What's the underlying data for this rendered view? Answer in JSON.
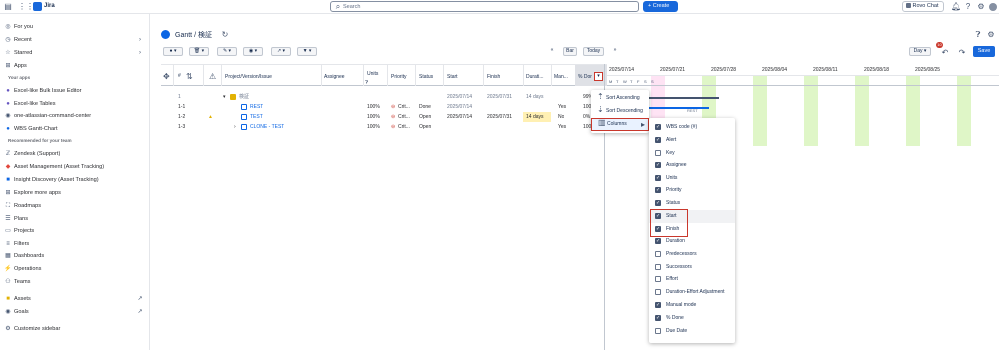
{
  "app": {
    "name": "Jira"
  },
  "topbar": {
    "search_placeholder": "Search",
    "create_label": "Create",
    "rovo_label": "Rovo Chat",
    "badge": "10"
  },
  "sidebar": {
    "items_top": [
      {
        "label": "For you",
        "icon": "target-icon"
      },
      {
        "label": "Recent",
        "icon": "clock-icon",
        "chevron": true
      },
      {
        "label": "Starred",
        "icon": "star-icon",
        "chevron": true
      },
      {
        "label": "Apps",
        "icon": "apps-icon",
        "chevron": false
      }
    ],
    "your_apps_heading": "Your apps",
    "your_apps": [
      {
        "label": "Excel-like Bulk Issue Editor"
      },
      {
        "label": "Excel-like Tables"
      },
      {
        "label": "one-atlassian-command-center"
      },
      {
        "label": "WBS Gantt-Chart"
      }
    ],
    "recommended_heading": "Recommended for your team",
    "recommended": [
      {
        "label": "Zendesk (Support)"
      },
      {
        "label": "Asset Management (Asset Tracking)"
      },
      {
        "label": "Insight Discovery (Asset Tracking)"
      },
      {
        "label": "Explore more apps"
      }
    ],
    "items_bottom": [
      {
        "label": "Roadmaps"
      },
      {
        "label": "Plans"
      },
      {
        "label": "Projects"
      },
      {
        "label": "Filters"
      },
      {
        "label": "Dashboards"
      },
      {
        "label": "Operations"
      },
      {
        "label": "Teams"
      },
      {
        "label": "Assets"
      },
      {
        "label": "Goals"
      },
      {
        "label": "Customize sidebar"
      }
    ]
  },
  "page": {
    "title": "Gantt / 検証"
  },
  "toolbar": {
    "bar_label": "Bar",
    "today_label": "Today",
    "day_label": "Day",
    "save_label": "Save"
  },
  "grid": {
    "headers": [
      "#",
      "Project/Version/Issue",
      "Assignee",
      "Units",
      "Priority",
      "Status",
      "Start",
      "Finish",
      "Durati...",
      "Man...",
      "% Dor"
    ],
    "rows": [
      {
        "num": "1",
        "issue": "検証",
        "units": "",
        "priority": "",
        "status": "",
        "start": "2025/07/14",
        "finish": "2025/07/31",
        "duration": "14 days",
        "manual": "",
        "done": "99%"
      },
      {
        "num": "1-1",
        "issue": "REST",
        "units": "100%",
        "priority": "Crit...",
        "status": "Done",
        "start": "2025/07/14",
        "finish": "",
        "duration": "",
        "manual": "Yes",
        "done": "100"
      },
      {
        "num": "1-2",
        "issue": "TEST",
        "units": "100%",
        "priority": "Crit...",
        "status": "Open",
        "start": "2025/07/14",
        "finish": "2025/07/31",
        "duration": "14 days",
        "manual": "No",
        "done": "0%"
      },
      {
        "num": "1-3",
        "issue": "CLONE - TEST",
        "units": "100%",
        "priority": "Crit...",
        "status": "Open",
        "start": "",
        "finish": "",
        "duration": "",
        "manual": "Yes",
        "done": "100"
      }
    ]
  },
  "gantt": {
    "weeks": [
      "2025/07/14",
      "2025/07/21",
      "2025/07/28",
      "2025/08/04",
      "2025/08/11",
      "2025/08/18",
      "2025/08/25"
    ],
    "days": [
      "M",
      "T",
      "W",
      "T",
      "F",
      "S",
      "S"
    ],
    "bar_label": "REST"
  },
  "sort_menu": {
    "items": [
      {
        "label": "Sort Ascending"
      },
      {
        "label": "Sort Descending"
      },
      {
        "label": "Columns"
      }
    ]
  },
  "columns_menu": {
    "items": [
      {
        "label": "WBS code (#)",
        "checked": true
      },
      {
        "label": "Alert",
        "checked": true
      },
      {
        "label": "Key",
        "checked": false
      },
      {
        "label": "Assignee",
        "checked": true
      },
      {
        "label": "Units",
        "checked": true
      },
      {
        "label": "Priority",
        "checked": true
      },
      {
        "label": "Status",
        "checked": true
      },
      {
        "label": "Start",
        "checked": true
      },
      {
        "label": "Finish",
        "checked": true
      },
      {
        "label": "Duration",
        "checked": true
      },
      {
        "label": "Predecessors",
        "checked": false
      },
      {
        "label": "Successors",
        "checked": false
      },
      {
        "label": "Effort",
        "checked": false
      },
      {
        "label": "Duration-Effort Adjustment",
        "checked": false
      },
      {
        "label": "Manual mode",
        "checked": true
      },
      {
        "label": "% Done",
        "checked": true
      },
      {
        "label": "Due Date",
        "checked": false
      }
    ]
  },
  "colors": {
    "accent": "#0c66e4",
    "highlight": "#c9372c",
    "weekend": "#dff6c7",
    "holiday": "#fdd0ec"
  }
}
